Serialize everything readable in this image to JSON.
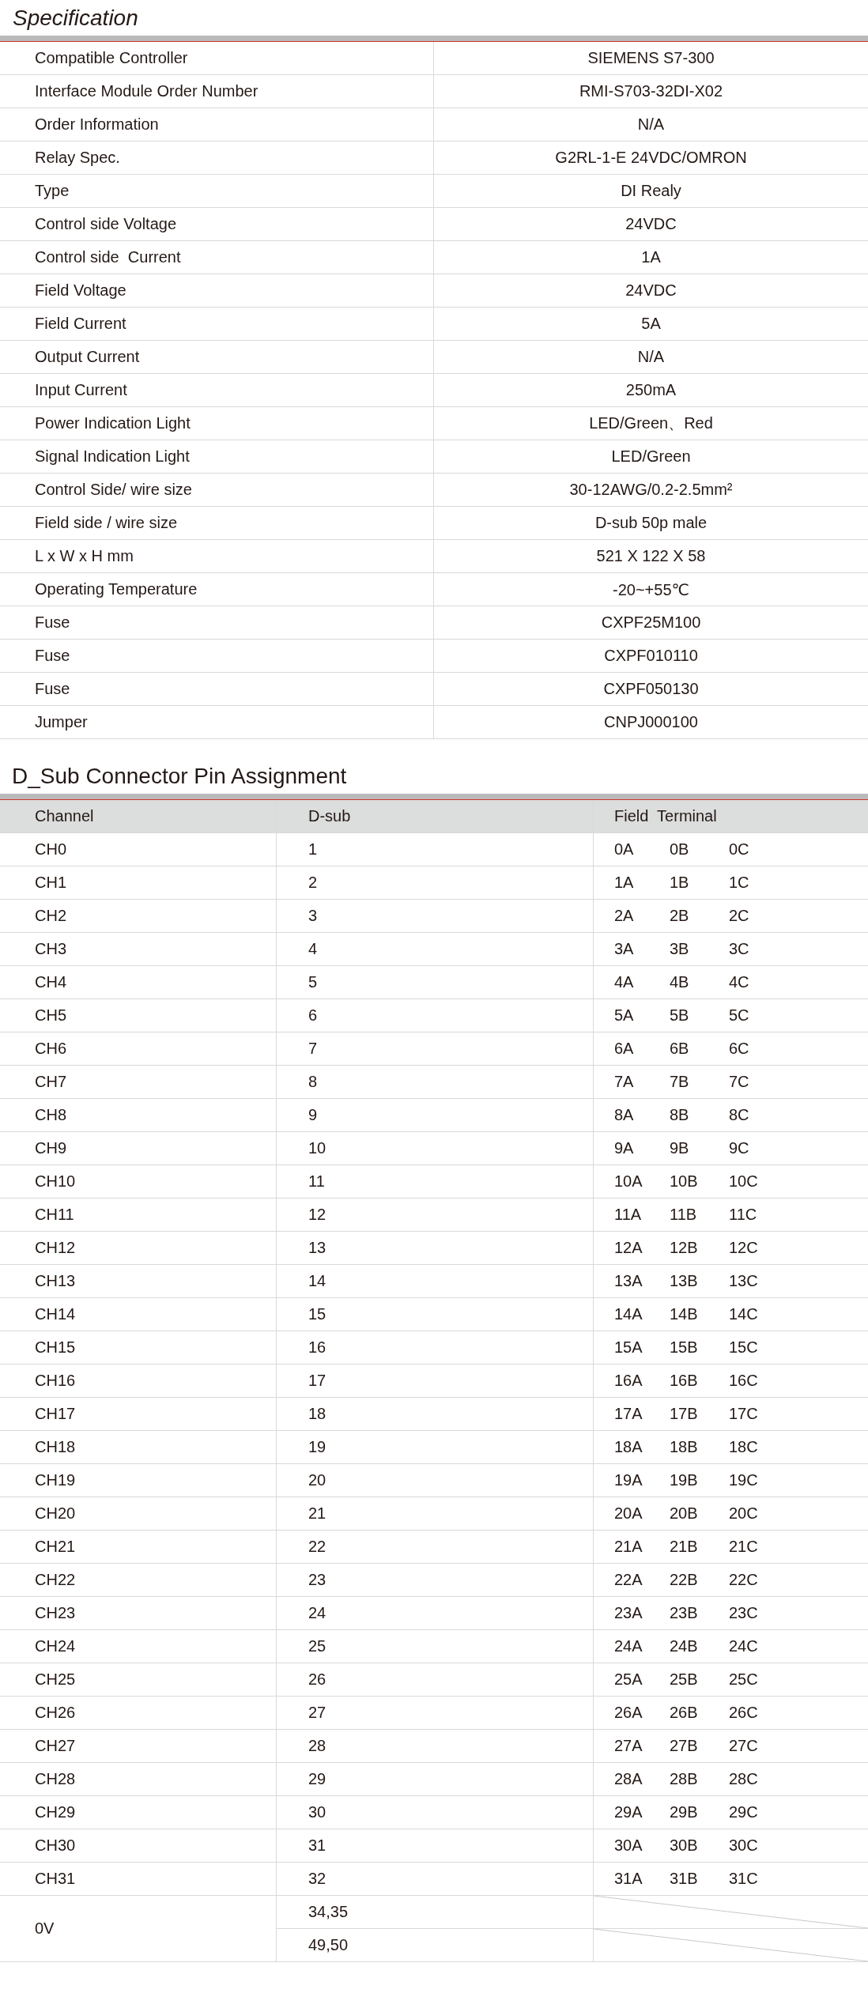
{
  "specification": {
    "title": "Specification",
    "rows": [
      {
        "label": "Compatible Controller",
        "value": "SIEMENS S7-300"
      },
      {
        "label": "Interface Module Order Number",
        "value": "RMI-S703-32DI-X02"
      },
      {
        "label": "Order Information",
        "value": "N/A"
      },
      {
        "label": "Relay Spec.",
        "value": "G2RL-1-E 24VDC/OMRON"
      },
      {
        "label": "Type",
        "value": "DI Realy"
      },
      {
        "label": "Control side Voltage",
        "value": "24VDC"
      },
      {
        "label": "Control side  Current",
        "value": "1A"
      },
      {
        "label": "Field Voltage",
        "value": "24VDC"
      },
      {
        "label": "Field Current",
        "value": "5A"
      },
      {
        "label": "Output Current",
        "value": "N/A"
      },
      {
        "label": "Input Current",
        "value": "250mA"
      },
      {
        "label": "Power Indication Light",
        "value": "LED/Green、Red"
      },
      {
        "label": "Signal Indication Light",
        "value": "LED/Green"
      },
      {
        "label": "Control Side/ wire size",
        "value": "30-12AWG/0.2-2.5mm²"
      },
      {
        "label": "Field side / wire size",
        "value": "D-sub 50p male"
      },
      {
        "label": "L x W x H mm",
        "value": "521 X 122 X 58"
      },
      {
        "label": "Operating Temperature",
        "value": "-20~+55℃"
      },
      {
        "label": "Fuse",
        "value": "CXPF25M100"
      },
      {
        "label": "Fuse",
        "value": "CXPF010110"
      },
      {
        "label": "Fuse",
        "value": "CXPF050130"
      },
      {
        "label": "Jumper",
        "value": "CNPJ000100"
      }
    ]
  },
  "pin_assignment": {
    "title": "D_Sub Connector Pin Assignment",
    "columns": [
      "Channel",
      "D-sub",
      "Field  Terminal"
    ],
    "rows": [
      {
        "kind": "pins",
        "channel": "CH0",
        "d_sub": "1",
        "field_terminal": [
          "0A",
          "0B",
          "0C"
        ]
      },
      {
        "kind": "pins",
        "channel": "CH1",
        "d_sub": "2",
        "field_terminal": [
          "1A",
          "1B",
          "1C"
        ]
      },
      {
        "kind": "pins",
        "channel": "CH2",
        "d_sub": "3",
        "field_terminal": [
          "2A",
          "2B",
          "2C"
        ]
      },
      {
        "kind": "pins",
        "channel": "CH3",
        "d_sub": "4",
        "field_terminal": [
          "3A",
          "3B",
          "3C"
        ]
      },
      {
        "kind": "pins",
        "channel": "CH4",
        "d_sub": "5",
        "field_terminal": [
          "4A",
          "4B",
          "4C"
        ]
      },
      {
        "kind": "pins",
        "channel": "CH5",
        "d_sub": "6",
        "field_terminal": [
          "5A",
          "5B",
          "5C"
        ]
      },
      {
        "kind": "pins",
        "channel": "CH6",
        "d_sub": "7",
        "field_terminal": [
          "6A",
          "6B",
          "6C"
        ]
      },
      {
        "kind": "pins",
        "channel": "CH7",
        "d_sub": "8",
        "field_terminal": [
          "7A",
          "7B",
          "7C"
        ]
      },
      {
        "kind": "pins",
        "channel": "CH8",
        "d_sub": "9",
        "field_terminal": [
          "8A",
          "8B",
          "8C"
        ]
      },
      {
        "kind": "pins",
        "channel": "CH9",
        "d_sub": "10",
        "field_terminal": [
          "9A",
          "9B",
          "9C"
        ]
      },
      {
        "kind": "pins",
        "channel": "CH10",
        "d_sub": "11",
        "field_terminal": [
          "10A",
          "10B",
          "10C"
        ]
      },
      {
        "kind": "pins",
        "channel": "CH11",
        "d_sub": "12",
        "field_terminal": [
          "11A",
          "11B",
          "11C"
        ]
      },
      {
        "kind": "pins",
        "channel": "CH12",
        "d_sub": "13",
        "field_terminal": [
          "12A",
          "12B",
          "12C"
        ]
      },
      {
        "kind": "pins",
        "channel": "CH13",
        "d_sub": "14",
        "field_terminal": [
          "13A",
          "13B",
          "13C"
        ]
      },
      {
        "kind": "pins",
        "channel": "CH14",
        "d_sub": "15",
        "field_terminal": [
          "14A",
          "14B",
          "14C"
        ]
      },
      {
        "kind": "pins",
        "channel": "CH15",
        "d_sub": "16",
        "field_terminal": [
          "15A",
          "15B",
          "15C"
        ]
      },
      {
        "kind": "pins",
        "channel": "CH16",
        "d_sub": "17",
        "field_terminal": [
          "16A",
          "16B",
          "16C"
        ]
      },
      {
        "kind": "pins",
        "channel": "CH17",
        "d_sub": "18",
        "field_terminal": [
          "17A",
          "17B",
          "17C"
        ]
      },
      {
        "kind": "pins",
        "channel": "CH18",
        "d_sub": "19",
        "field_terminal": [
          "18A",
          "18B",
          "18C"
        ]
      },
      {
        "kind": "pins",
        "channel": "CH19",
        "d_sub": "20",
        "field_terminal": [
          "19A",
          "19B",
          "19C"
        ]
      },
      {
        "kind": "pins",
        "channel": "CH20",
        "d_sub": "21",
        "field_terminal": [
          "20A",
          "20B",
          "20C"
        ]
      },
      {
        "kind": "pins",
        "channel": "CH21",
        "d_sub": "22",
        "field_terminal": [
          "21A",
          "21B",
          "21C"
        ]
      },
      {
        "kind": "pins",
        "channel": "CH22",
        "d_sub": "23",
        "field_terminal": [
          "22A",
          "22B",
          "22C"
        ]
      },
      {
        "kind": "pins",
        "channel": "CH23",
        "d_sub": "24",
        "field_terminal": [
          "23A",
          "23B",
          "23C"
        ]
      },
      {
        "kind": "pins",
        "channel": "CH24",
        "d_sub": "25",
        "field_terminal": [
          "24A",
          "24B",
          "24C"
        ]
      },
      {
        "kind": "pins",
        "channel": "CH25",
        "d_sub": "26",
        "field_terminal": [
          "25A",
          "25B",
          "25C"
        ]
      },
      {
        "kind": "pins",
        "channel": "CH26",
        "d_sub": "27",
        "field_terminal": [
          "26A",
          "26B",
          "26C"
        ]
      },
      {
        "kind": "pins",
        "channel": "CH27",
        "d_sub": "28",
        "field_terminal": [
          "27A",
          "27B",
          "27C"
        ]
      },
      {
        "kind": "pins",
        "channel": "CH28",
        "d_sub": "29",
        "field_terminal": [
          "28A",
          "28B",
          "28C"
        ]
      },
      {
        "kind": "pins",
        "channel": "CH29",
        "d_sub": "30",
        "field_terminal": [
          "29A",
          "29B",
          "29C"
        ]
      },
      {
        "kind": "pins",
        "channel": "CH30",
        "d_sub": "31",
        "field_terminal": [
          "30A",
          "30B",
          "30C"
        ]
      },
      {
        "kind": "pins",
        "channel": "CH31",
        "d_sub": "32",
        "field_terminal": [
          "31A",
          "31B",
          "31C"
        ]
      },
      {
        "kind": "split",
        "channel": "0V",
        "d_sub": [
          "34,35",
          "49,50"
        ]
      }
    ]
  }
}
